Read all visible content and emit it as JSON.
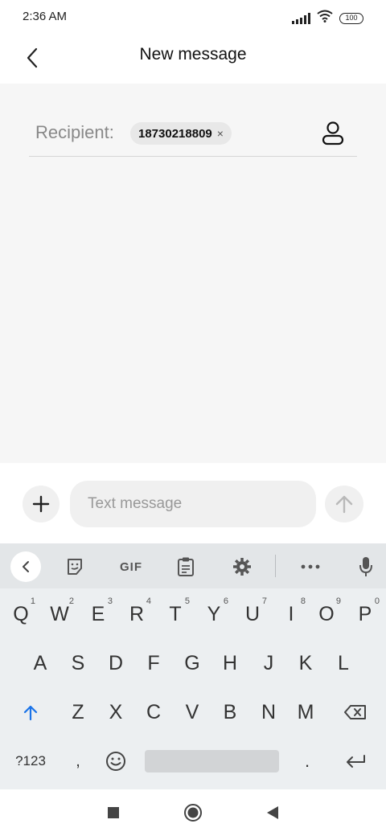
{
  "status": {
    "time": "2:36 AM",
    "battery": "100"
  },
  "header": {
    "title": "New message"
  },
  "recipient": {
    "label": "Recipient:",
    "chip_text": "18730218809",
    "chip_remove": "×"
  },
  "composer": {
    "placeholder": "Text message"
  },
  "keyboard": {
    "toolbar": {
      "gif": "GIF"
    },
    "row1": [
      {
        "label": "Q",
        "hint": "1"
      },
      {
        "label": "W",
        "hint": "2"
      },
      {
        "label": "E",
        "hint": "3"
      },
      {
        "label": "R",
        "hint": "4"
      },
      {
        "label": "T",
        "hint": "5"
      },
      {
        "label": "Y",
        "hint": "6"
      },
      {
        "label": "U",
        "hint": "7"
      },
      {
        "label": "I",
        "hint": "8"
      },
      {
        "label": "O",
        "hint": "9"
      },
      {
        "label": "P",
        "hint": "0"
      }
    ],
    "row2": [
      "A",
      "S",
      "D",
      "F",
      "G",
      "H",
      "J",
      "K",
      "L"
    ],
    "row3": [
      "Z",
      "X",
      "C",
      "V",
      "B",
      "N",
      "M"
    ],
    "row4": {
      "symbols": "?123",
      "comma": ",",
      "period": "."
    }
  },
  "colors": {
    "accent": "#1a73e8",
    "content_bg": "#f6f6f6",
    "keyboard_bg": "#eceff1"
  }
}
